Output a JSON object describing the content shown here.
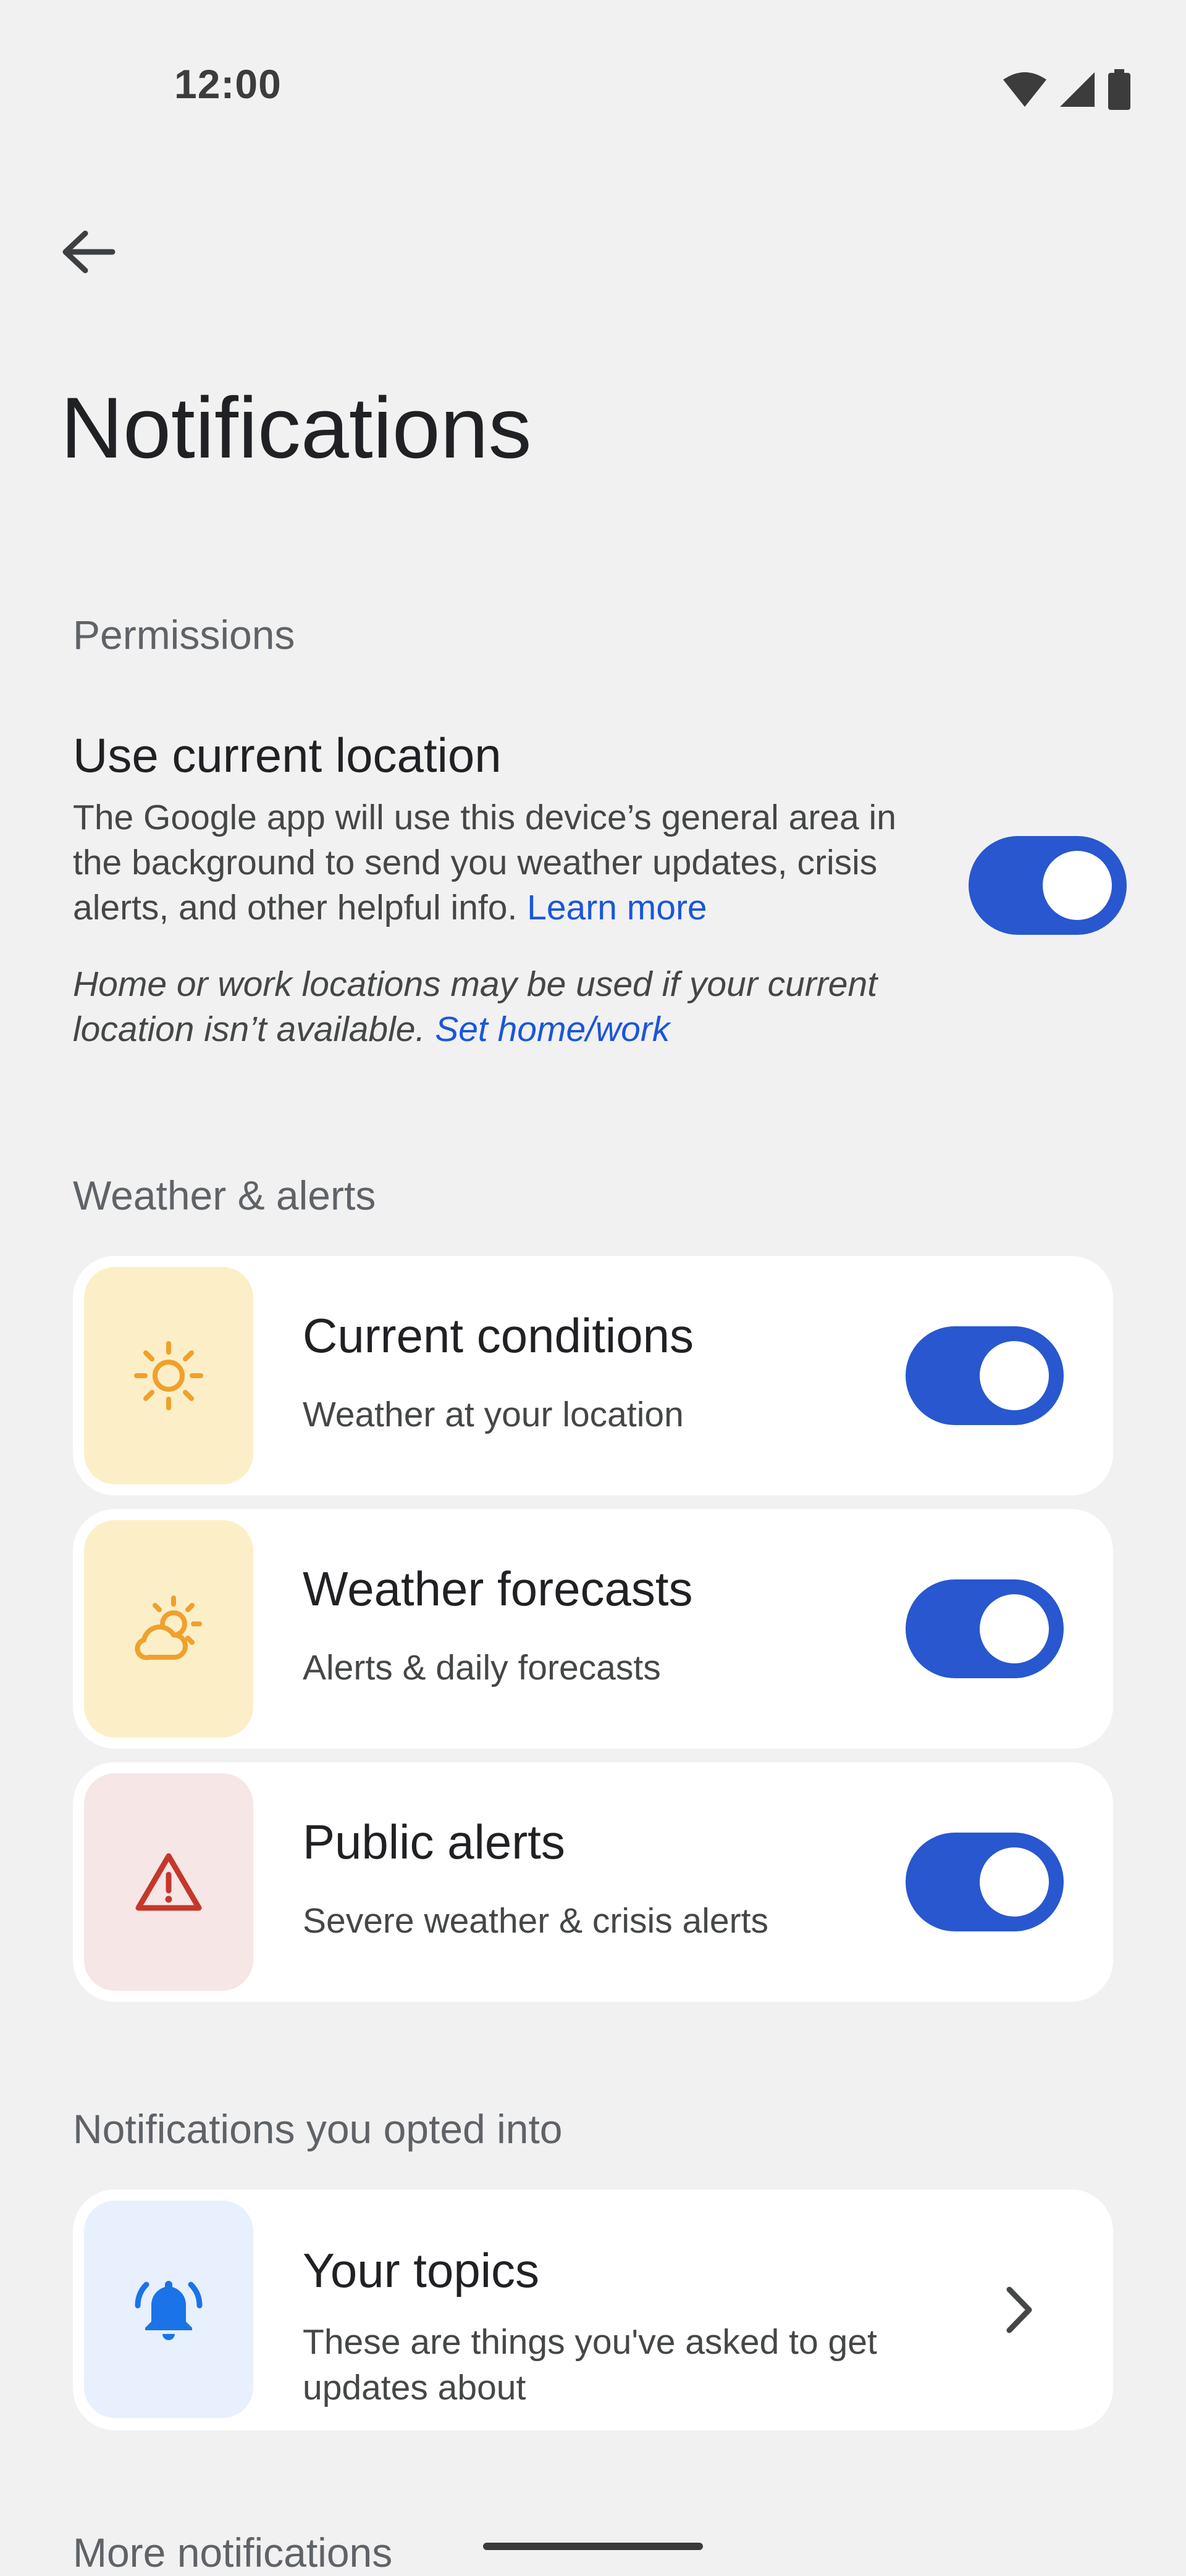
{
  "status_bar": {
    "time": "12:00"
  },
  "header": {
    "title": "Notifications"
  },
  "permissions": {
    "section_label": "Permissions",
    "title": "Use current location",
    "description": "The Google app will use this device’s general area in the background to send you weather updates, crisis alerts, and other helpful info.",
    "learn_more": "Learn more",
    "note": "Home or work locations may be used if your current location isn’t available.",
    "set_home_work": "Set home/work",
    "toggle_on": true
  },
  "weather_alerts": {
    "section_label": "Weather & alerts",
    "items": [
      {
        "title": "Current conditions",
        "subtitle": "Weather at your location",
        "icon": "sun-icon",
        "toggle_on": true
      },
      {
        "title": "Weather forecasts",
        "subtitle": "Alerts & daily forecasts",
        "icon": "partly-cloudy-icon",
        "toggle_on": true
      },
      {
        "title": "Public alerts",
        "subtitle": "Severe weather & crisis alerts",
        "icon": "warning-icon",
        "toggle_on": true
      }
    ]
  },
  "opted_in": {
    "section_label": "Notifications you opted into",
    "topics_title": "Your topics",
    "topics_subtitle": "These are things you've asked to get updates about",
    "icon": "bell-ringing-icon"
  },
  "more": {
    "section_label": "More notifications"
  },
  "colors": {
    "accent": "#2857cf",
    "link": "#1a56db",
    "sun_tile": "#fcefc8",
    "alert_tile": "#f6e6e5",
    "topics_tile": "#e8effd"
  }
}
